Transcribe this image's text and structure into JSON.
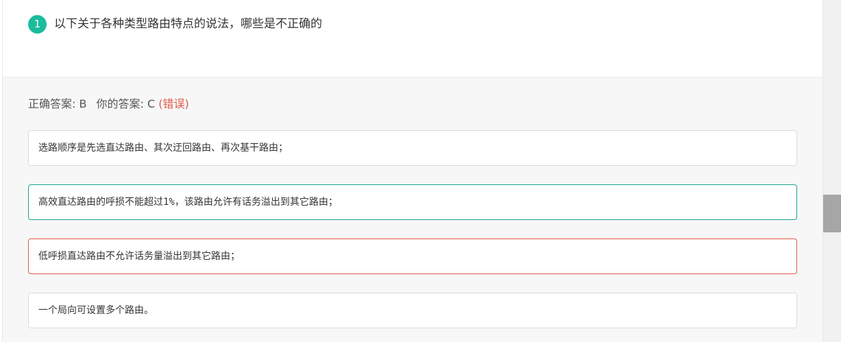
{
  "question": {
    "number": "1",
    "text": "以下关于各种类型路由特点的说法，哪些是不正确的"
  },
  "result": {
    "correct_label": "正确答案: B",
    "your_label": "你的答案: C",
    "status": "(错误)"
  },
  "options": [
    {
      "text": "选路顺序是先选直达路由、其次迂回路由、再次基干路由；",
      "state": "normal"
    },
    {
      "text": "高效直达路由的呼损不能超过1%，该路由允许有话务溢出到其它路由；",
      "state": "correct"
    },
    {
      "text": "低呼损直达路由不允许话务量溢出到其它路由；",
      "state": "wrong"
    },
    {
      "text": "一个局向可设置多个路由。",
      "state": "normal"
    }
  ],
  "colors": {
    "accent": "#1abc9c",
    "correct_border": "#1aa590",
    "wrong": "#e05a4b"
  }
}
